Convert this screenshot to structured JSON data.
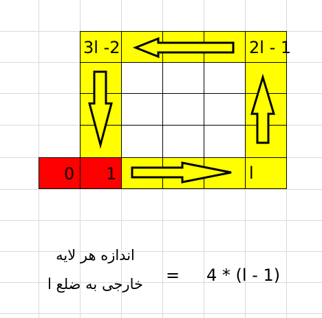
{
  "diagram": {
    "labels": {
      "top_left": "3l -2",
      "top_right": "2l - 1",
      "bottom_right": "l",
      "start_zero": "0",
      "start_one": "1"
    },
    "caption": {
      "line1": "اندازه هر لایه",
      "line2": "خارجی به ضلع l"
    },
    "equals": "=",
    "formula": "4 * (l - 1)",
    "colors": {
      "highlight": "#ffff00",
      "start": "#ff0000",
      "grid": "#d9d9d9"
    }
  }
}
